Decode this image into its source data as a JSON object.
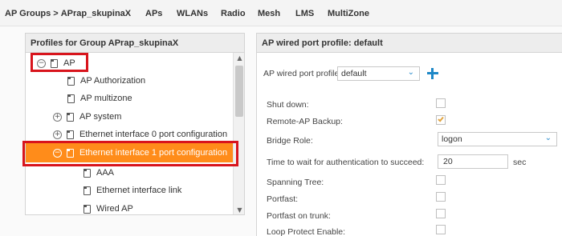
{
  "breadcrumb": {
    "root": "AP Groups",
    "separator": ">",
    "current": "APrap_skupinaX"
  },
  "tabs": [
    "APs",
    "WLANs",
    "Radio",
    "Mesh",
    "LMS",
    "MultiZone"
  ],
  "profiles_panel": {
    "title": "Profiles for Group APrap_skupinaX",
    "items": [
      {
        "label": "AP",
        "toggle": "minus"
      },
      {
        "label": "AP Authorization",
        "toggle": ""
      },
      {
        "label": "AP multizone",
        "toggle": ""
      },
      {
        "label": "AP system",
        "toggle": "plus"
      },
      {
        "label": "Ethernet interface 0 port configuration",
        "toggle": "plus"
      },
      {
        "label": "Ethernet interface 1 port configuration",
        "toggle": "minus",
        "selected": true
      },
      {
        "label": "AAA",
        "toggle": ""
      },
      {
        "label": "Ethernet interface link",
        "toggle": ""
      },
      {
        "label": "Wired AP",
        "toggle": ""
      }
    ],
    "selected_color": "#ff8c1a"
  },
  "detail_panel": {
    "title": "AP wired port profile: default",
    "profile_label": "AP wired port profile:",
    "profile_value": "default",
    "fields": {
      "shutdown": {
        "label": "Shut down:",
        "checked": false
      },
      "remote_ap_backup": {
        "label": "Remote-AP Backup:",
        "checked": true
      },
      "bridge_role": {
        "label": "Bridge Role:",
        "value": "logon"
      },
      "auth_wait": {
        "label": "Time to wait for authentication to succeed:",
        "value": "20",
        "unit": "sec"
      },
      "spanning_tree": {
        "label": "Spanning Tree:",
        "checked": false
      },
      "portfast": {
        "label": "Portfast:",
        "checked": false
      },
      "portfast_trunk": {
        "label": "Portfast on trunk:",
        "checked": false
      },
      "loop_protect": {
        "label": "Loop Protect Enable:",
        "checked": false
      }
    }
  },
  "colors": {
    "highlight_border": "#d8141c",
    "accent_blue": "#1e88c7",
    "checkmark": "#e2a542"
  },
  "icons": {
    "expand": "plus-circle-icon",
    "collapse": "minus-circle-icon",
    "profile": "document-icon",
    "add": "plus-icon",
    "dropdown": "chevron-down-icon"
  }
}
